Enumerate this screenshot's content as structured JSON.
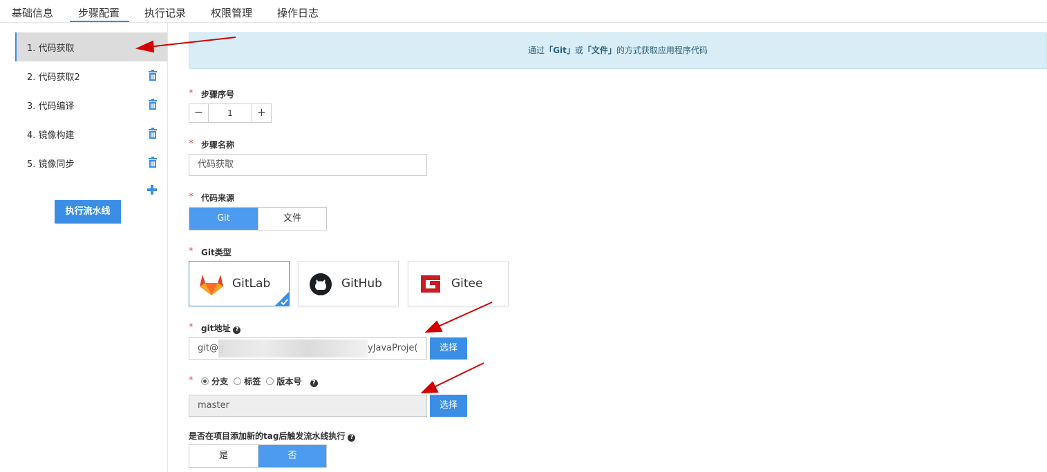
{
  "tabs": [
    {
      "label": "基础信息"
    },
    {
      "label": "步骤配置"
    },
    {
      "label": "执行记录"
    },
    {
      "label": "权限管理"
    },
    {
      "label": "操作日志"
    }
  ],
  "active_tab": "步骤配置",
  "steps": [
    {
      "label": "1. 代码获取"
    },
    {
      "label": "2. 代码获取2"
    },
    {
      "label": "3. 代码编译"
    },
    {
      "label": "4. 镜像构建"
    },
    {
      "label": "5. 镜像同步"
    }
  ],
  "run_pipeline_label": "执行流水线",
  "notice": {
    "prefix": "通过",
    "git": "「Git」",
    "or": "或",
    "file": "「文件」",
    "suffix": "的方式获取应用程序代码"
  },
  "form": {
    "required_mark": "*",
    "step_order": {
      "label": "步骤序号",
      "value": "1",
      "minus": "−",
      "plus": "+"
    },
    "step_name": {
      "label": "步骤名称",
      "value": "代码获取"
    },
    "code_source": {
      "label": "代码来源",
      "options": [
        "Git",
        "文件"
      ],
      "selected": "Git"
    },
    "git_type": {
      "label": "Git类型",
      "options": [
        "GitLab",
        "GitHub",
        "Gitee"
      ],
      "selected": "GitLab"
    },
    "git_url": {
      "label": "git地址",
      "value_start": "git@g",
      "value_end": "yJavaProje(",
      "button": "选择"
    },
    "ref_type": {
      "options": [
        "分支",
        "标签",
        "版本号"
      ],
      "selected": "分支"
    },
    "branch": {
      "value": "master",
      "button": "选择"
    },
    "trigger_on_tag": {
      "label": "是否在项目添加新的tag后触发流水线执行",
      "options": [
        "是",
        "否"
      ],
      "selected": "否"
    }
  },
  "colors": {
    "primary": "#3a8ee6",
    "notice_bg": "#d8edf6",
    "required": "#e04848",
    "annotation_arrow": "#d40000"
  }
}
